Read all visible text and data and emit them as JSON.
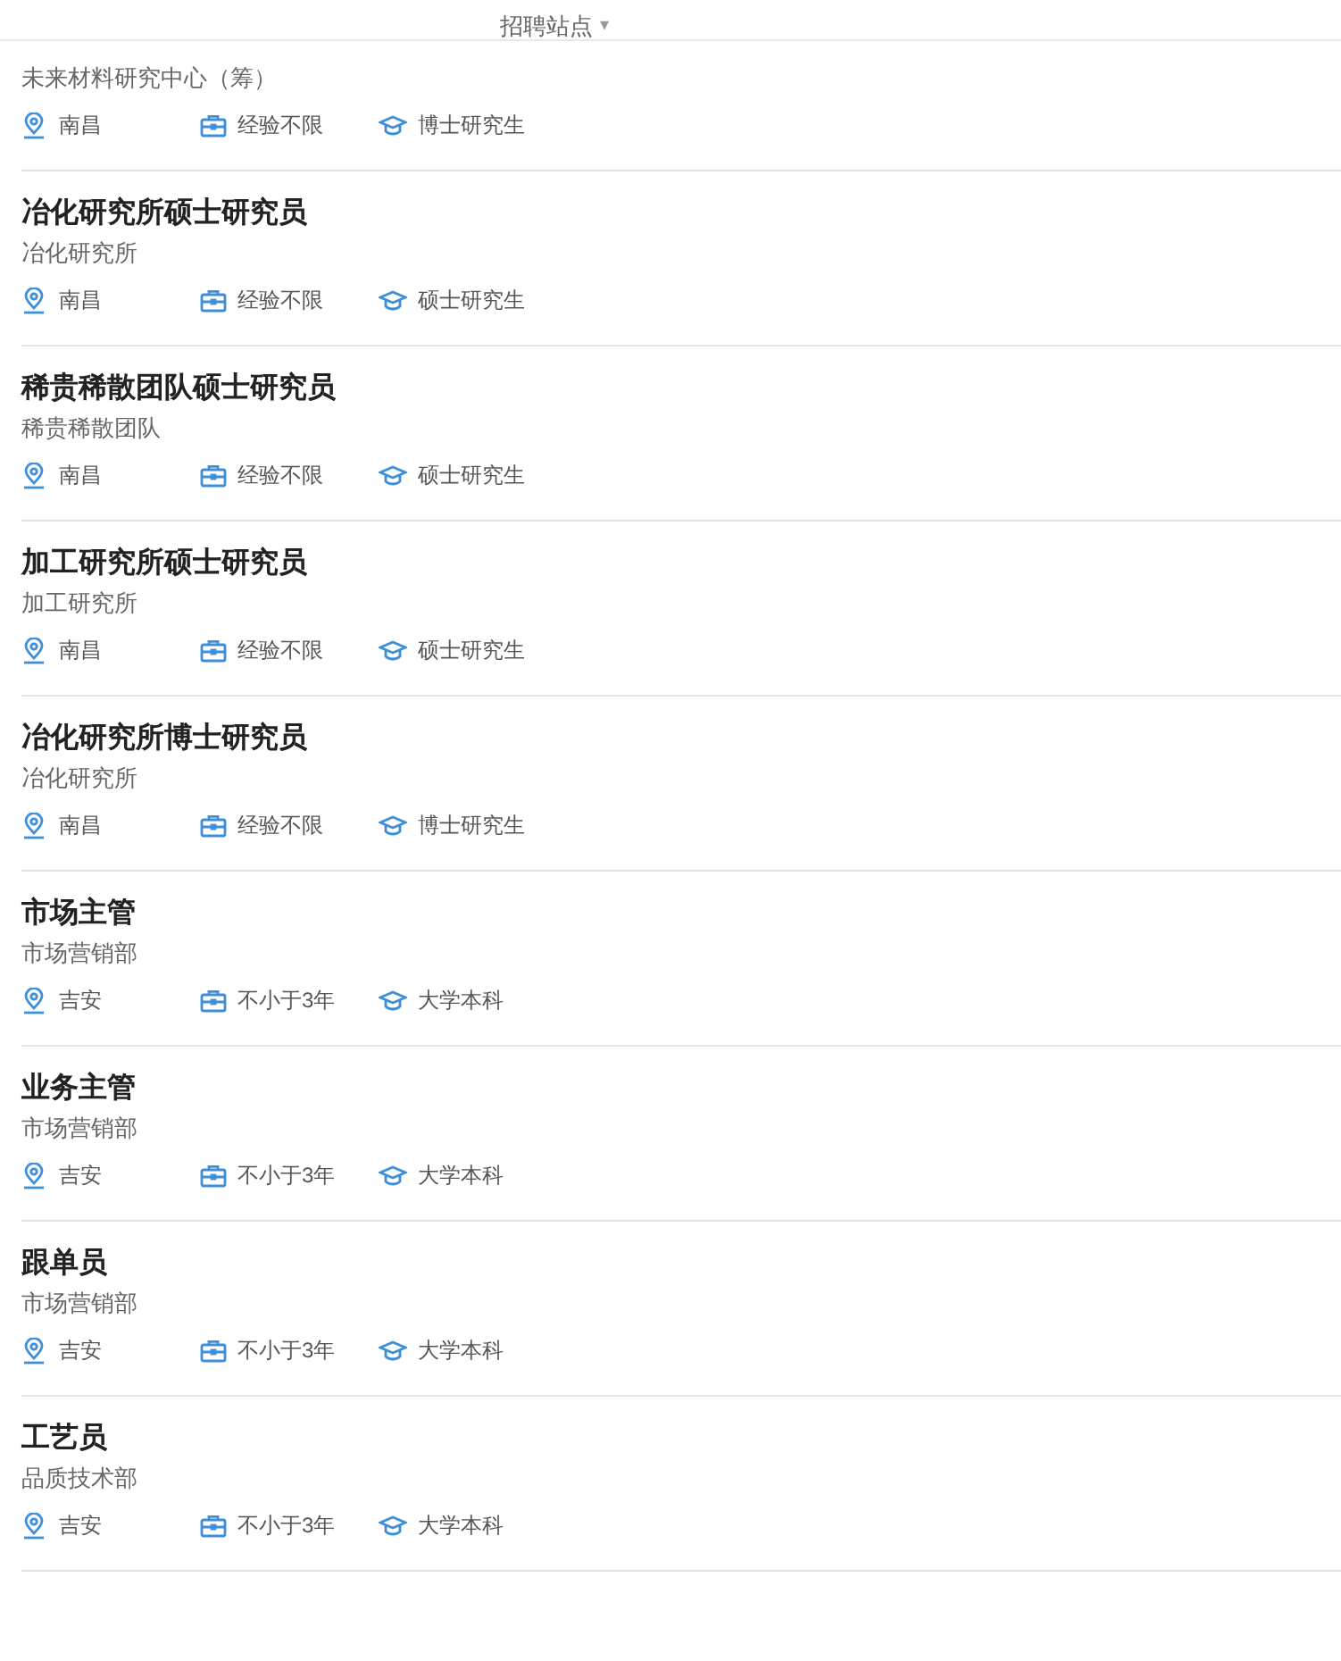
{
  "header": {
    "title": "招聘站点",
    "caret": "▾"
  },
  "jobs": [
    {
      "department": "未来材料研究中心（筹）",
      "location": "南昌",
      "experience": "经验不限",
      "education": "博士研究生"
    },
    {
      "title": "冶化研究所硕士研究员",
      "department": "冶化研究所",
      "location": "南昌",
      "experience": "经验不限",
      "education": "硕士研究生"
    },
    {
      "title": "稀贵稀散团队硕士研究员",
      "department": "稀贵稀散团队",
      "location": "南昌",
      "experience": "经验不限",
      "education": "硕士研究生"
    },
    {
      "title": "加工研究所硕士研究员",
      "department": "加工研究所",
      "location": "南昌",
      "experience": "经验不限",
      "education": "硕士研究生"
    },
    {
      "title": "冶化研究所博士研究员",
      "department": "冶化研究所",
      "location": "南昌",
      "experience": "经验不限",
      "education": "博士研究生"
    },
    {
      "title": "市场主管",
      "department": "市场营销部",
      "location": "吉安",
      "experience": "不小于3年",
      "education": "大学本科"
    },
    {
      "title": "业务主管",
      "department": "市场营销部",
      "location": "吉安",
      "experience": "不小于3年",
      "education": "大学本科"
    },
    {
      "title": "跟单员",
      "department": "市场营销部",
      "location": "吉安",
      "experience": "不小于3年",
      "education": "大学本科"
    },
    {
      "title": "工艺员",
      "department": "品质技术部",
      "location": "吉安",
      "experience": "不小于3年",
      "education": "大学本科"
    }
  ]
}
